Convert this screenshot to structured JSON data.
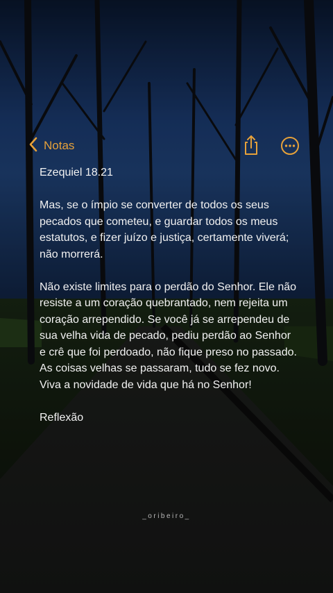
{
  "nav": {
    "back_label": "Notas",
    "back_icon": "chevron-left-icon",
    "share_icon": "share-icon",
    "more_icon": "more-circle-icon",
    "accent_color": "#e6a13a"
  },
  "note": {
    "title": "Ezequiel 18.21",
    "paragraph1": "Mas, se o ímpio se converter de todos os seus pecados que cometeu, e guardar todos os meus estatutos, e fizer juízo e justiça, certamente viverá; não morrerá.",
    "paragraph2": "Não existe limites para o perdão do Senhor. Ele não resiste a um coração quebrantado, nem rejeita um coração arrependido. Se você já se arrependeu de sua velha vida de pecado, pediu perdão ao Senhor e crê que foi perdoado, não fique preso no passado. As coisas velhas se passaram, tudo se fez novo. Viva a novidade de vida que há no Senhor!",
    "footer": "Reflexão"
  },
  "watermark": "_oribeiro_"
}
